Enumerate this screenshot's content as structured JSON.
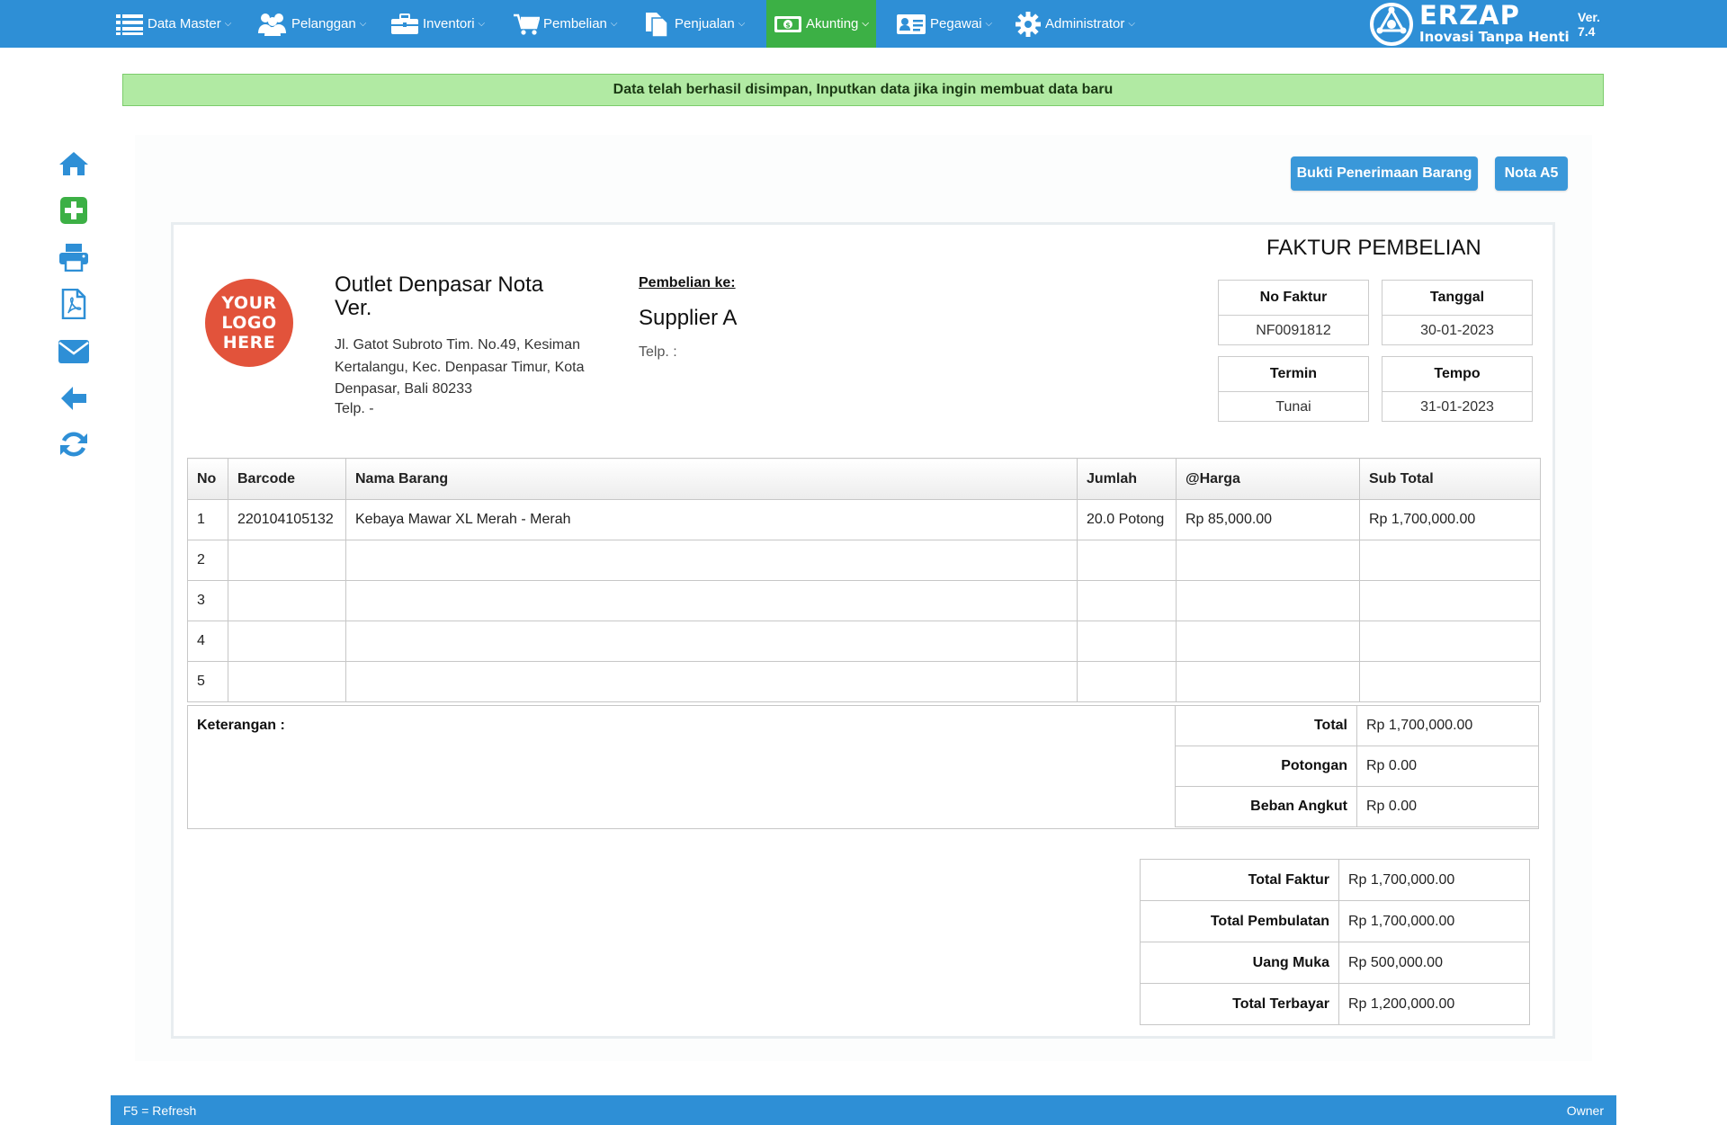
{
  "nav": {
    "items": [
      {
        "label": "Data Master",
        "icon": "list-icon"
      },
      {
        "label": "Pelanggan",
        "icon": "users-icon"
      },
      {
        "label": "Inventori",
        "icon": "briefcase-icon"
      },
      {
        "label": "Pembelian",
        "icon": "cart-icon"
      },
      {
        "label": "Penjualan",
        "icon": "documents-icon"
      },
      {
        "label": "Akunting",
        "icon": "money-icon",
        "active": true
      },
      {
        "label": "Pegawai",
        "icon": "id-card-icon"
      },
      {
        "label": "Administrator",
        "icon": "gear-icon"
      }
    ],
    "brand_name": "ERZAP",
    "brand_tagline": "Inovasi Tanpa Henti",
    "version": "Ver. 7.4"
  },
  "alert": {
    "message": "Data telah berhasil disimpan, Inputkan data jika ingin membuat data baru"
  },
  "sidebar_tools": [
    "home-icon",
    "add-icon",
    "print-icon",
    "pdf-icon",
    "email-icon",
    "back-icon",
    "refresh-icon"
  ],
  "actions": {
    "receipt_button": "Bukti Penerimaan Barang",
    "nota_button": "Nota A5"
  },
  "invoice": {
    "title": "FAKTUR PEMBELIAN",
    "logo_lines": [
      "YOUR",
      "LOGO",
      "HERE"
    ],
    "outlet_name": "Outlet Denpasar Nota Ver.",
    "outlet_address": "Jl. Gatot Subroto Tim. No.49, Kesiman Kertalangu, Kec. Denpasar Timur, Kota Denpasar, Bali 80233",
    "outlet_telp": "Telp. -",
    "purchase_to_label": "Pembelian ke:",
    "supplier": "Supplier A",
    "supplier_telp": "Telp.  :",
    "meta": {
      "no_faktur_label": "No Faktur",
      "no_faktur": "NF0091812",
      "tanggal_label": "Tanggal",
      "tanggal": "30-01-2023",
      "termin_label": "Termin",
      "termin": "Tunai",
      "tempo_label": "Tempo",
      "tempo": "31-01-2023"
    },
    "table": {
      "headers": [
        "No",
        "Barcode",
        "Nama Barang",
        "Jumlah",
        "@Harga",
        "Sub Total"
      ],
      "rows": [
        [
          "1",
          "220104105132",
          "Kebaya Mawar XL Merah - Merah",
          "20.0 Potong",
          "Rp 85,000.00",
          "Rp 1,700,000.00"
        ],
        [
          "2",
          "",
          "",
          "",
          "",
          ""
        ],
        [
          "3",
          "",
          "",
          "",
          "",
          ""
        ],
        [
          "4",
          "",
          "",
          "",
          "",
          ""
        ],
        [
          "5",
          "",
          "",
          "",
          "",
          ""
        ]
      ]
    },
    "keterangan_label": "Keterangan :",
    "summary": [
      {
        "label": "Total",
        "value": "Rp 1,700,000.00"
      },
      {
        "label": "Potongan",
        "value": "Rp 0.00"
      },
      {
        "label": "Beban Angkut",
        "value": "Rp 0.00"
      }
    ],
    "grand": [
      {
        "label": "Total Faktur",
        "value": "Rp 1,700,000.00"
      },
      {
        "label": "Total Pembulatan",
        "value": "Rp 1,700,000.00"
      },
      {
        "label": "Uang Muka",
        "value": "Rp 500,000.00"
      },
      {
        "label": "Total Terbayar",
        "value": "Rp 1,200,000.00"
      }
    ]
  },
  "footer": {
    "left": "F5 = Refresh",
    "right": "Owner"
  },
  "colors": {
    "nav": "#2e8fd6",
    "active": "#3cb045",
    "button": "#3a98d9",
    "alert": "#b1eaa3"
  }
}
